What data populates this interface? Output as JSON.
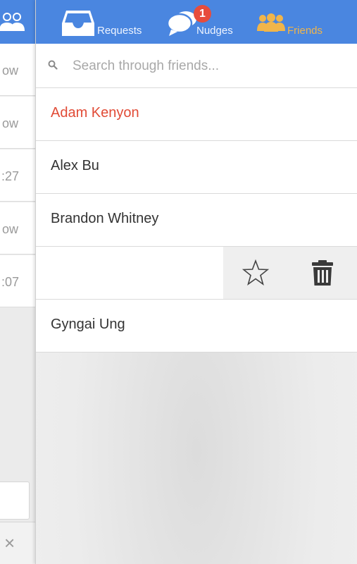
{
  "left_panel": {
    "rows": [
      {
        "time": "ow"
      },
      {
        "time": "ow"
      },
      {
        "time": ":27"
      },
      {
        "time": "ow"
      },
      {
        "time": ":07"
      }
    ],
    "close_glyph": "×"
  },
  "nav": {
    "tabs": [
      {
        "label": "Requests",
        "icon": "inbox-icon"
      },
      {
        "label": "Nudges",
        "icon": "chat-bubbles-icon",
        "badge": "1"
      },
      {
        "label": "Friends",
        "icon": "friends-icon",
        "active": true
      }
    ],
    "colors": {
      "bar": "#4a86e0",
      "active": "#f1b54a",
      "badge": "#e74c3c"
    }
  },
  "search": {
    "placeholder": "Search through friends...",
    "value": ""
  },
  "friends": [
    {
      "name": "Adam Kenyon",
      "highlighted": true
    },
    {
      "name": "Alex Bu"
    },
    {
      "name": "Brandon Whitney"
    },
    {
      "name": "",
      "swiped": true,
      "actions": [
        "star-icon",
        "trash-icon"
      ]
    },
    {
      "name": "Gyngai Ung"
    }
  ],
  "colors": {
    "highlight_name": "#e14b36"
  }
}
